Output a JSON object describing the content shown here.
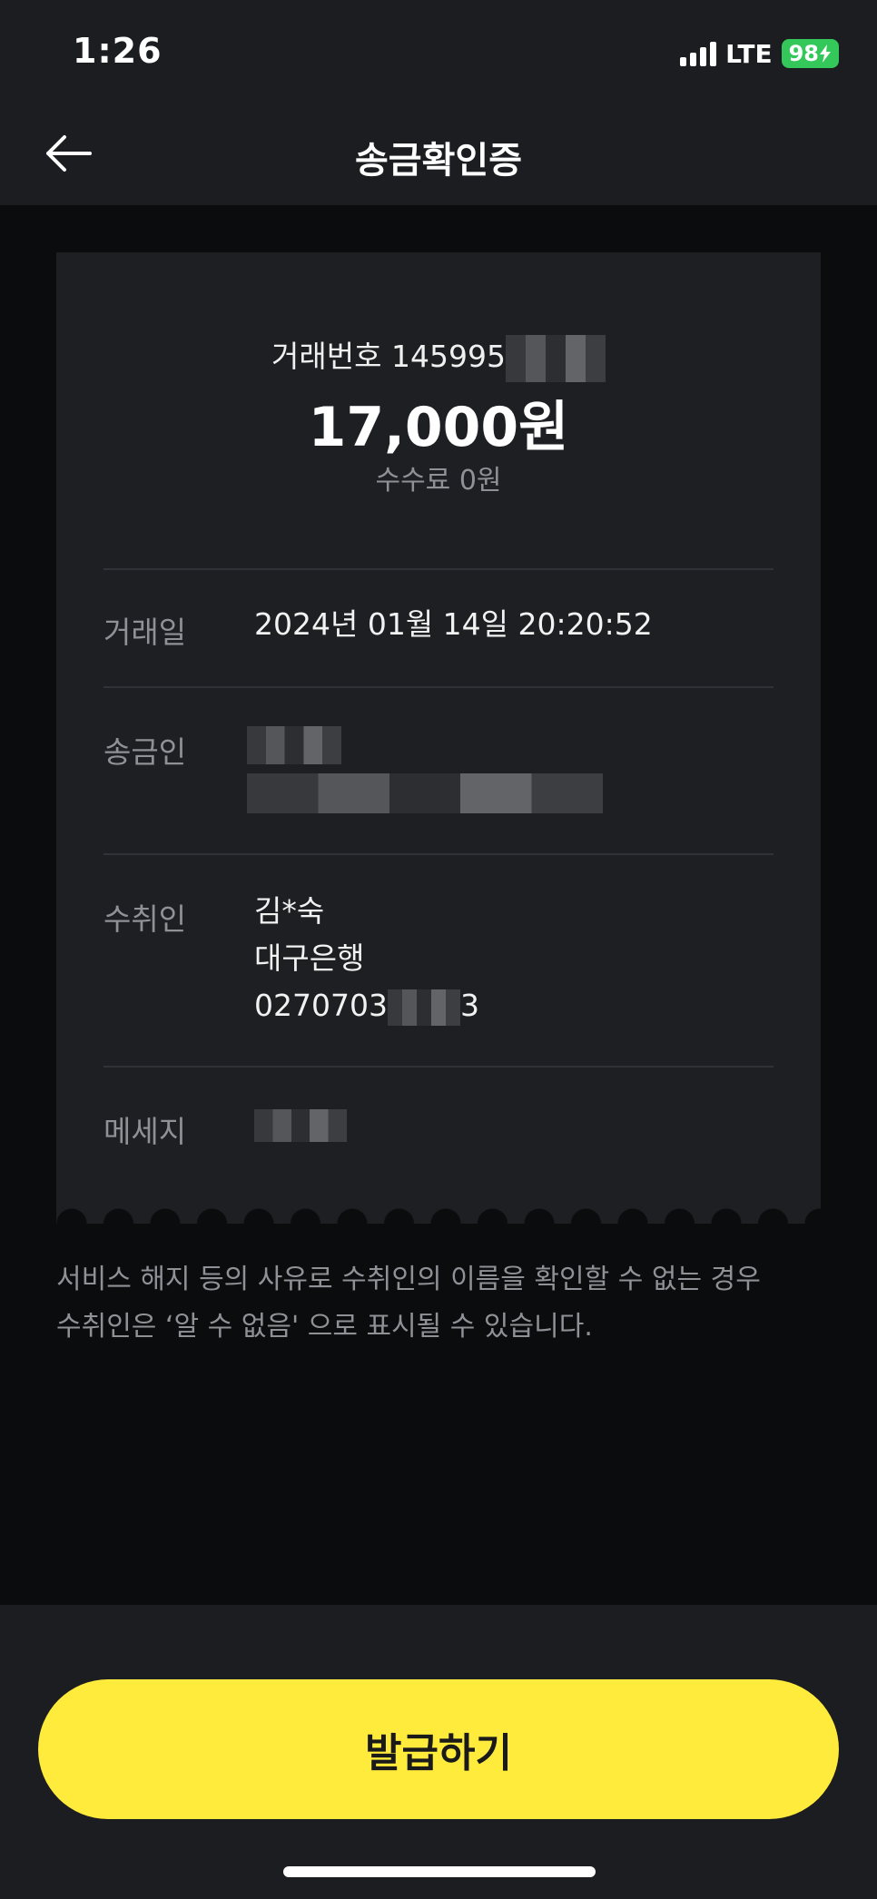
{
  "status_bar": {
    "time": "1:26",
    "network": "LTE",
    "battery": "98"
  },
  "header": {
    "title": "송금확인증",
    "back_icon": "arrow-left-icon"
  },
  "receipt": {
    "transaction_number_label": "거래번호 145995",
    "amount": "17,000원",
    "fee": "수수료 0원",
    "rows": {
      "date": {
        "label": "거래일",
        "value": "2024년 01월 14일 20:20:52"
      },
      "sender": {
        "label": "송금인"
      },
      "recipient": {
        "label": "수취인",
        "name": "김*숙",
        "bank": "대구은행",
        "account_prefix": "0270703",
        "account_suffix": "3"
      },
      "message": {
        "label": "메세지"
      }
    }
  },
  "notice": {
    "line1": "서비스 해지 등의 사유로 수취인의 이름을 확인할 수 없는 경우",
    "line2": "수취인은 ‘알 수 없음' 으로 표시될 수 있습니다."
  },
  "actions": {
    "issue_label": "발급하기"
  },
  "colors": {
    "accent": "#ffeb3b",
    "background": "#0b0c0e",
    "card": "#1d1f22",
    "battery": "#34c759"
  }
}
